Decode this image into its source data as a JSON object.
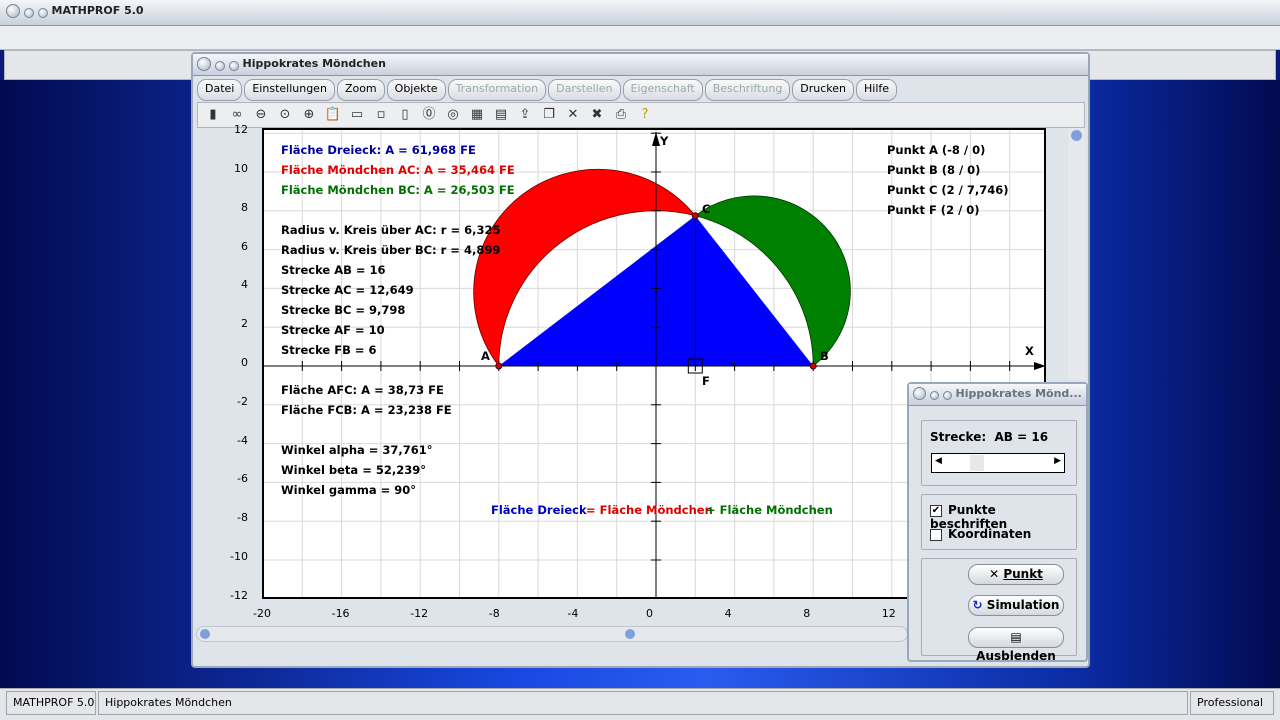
{
  "app": {
    "title": "MATHPROF 5.0"
  },
  "window": {
    "title": "Hippokrates Möndchen",
    "menu": [
      {
        "label": "Datei",
        "enabled": true
      },
      {
        "label": "Einstellungen",
        "enabled": true
      },
      {
        "label": "Zoom",
        "enabled": true
      },
      {
        "label": "Objekte",
        "enabled": true
      },
      {
        "label": "Transformation",
        "enabled": false
      },
      {
        "label": "Darstellen",
        "enabled": false
      },
      {
        "label": "Eigenschaft",
        "enabled": false
      },
      {
        "label": "Beschriftung",
        "enabled": false
      },
      {
        "label": "Drucken",
        "enabled": true
      },
      {
        "label": "Hilfe",
        "enabled": true
      }
    ],
    "toolbar": [
      "window-icon",
      "glasses-icon",
      "zoom-out-icon",
      "zoom-reset-icon",
      "zoom-in-icon",
      "clipboard-icon",
      "layout-icon",
      "frame-icon",
      "frame-double-icon",
      "circle-icon",
      "circle-at-icon",
      "table-icon",
      "document-icon",
      "export-icon",
      "copy-icon",
      "cross-icon",
      "cross-double-icon",
      "printer-icon",
      "help-icon"
    ]
  },
  "plot": {
    "info_colored": [
      {
        "text": "Fläche Dreieck: A = 61,968 FE",
        "color": "#0000a0"
      },
      {
        "text": "Fläche Möndchen AC: A = 35,464 FE",
        "color": "#e00000"
      },
      {
        "text": "Fläche Möndchen BC: A = 26,503 FE",
        "color": "#007000"
      }
    ],
    "info": [
      "Radius v. Kreis über AC: r = 6,325",
      "Radius v. Kreis über BC: r = 4,899",
      "Strecke AB = 16",
      "Strecke AC = 12,649",
      "Strecke BC = 9,798",
      "Strecke AF = 10",
      "Strecke FB = 6"
    ],
    "info2": [
      "Fläche AFC: A = 38,73 FE",
      "Fläche FCB: A = 23,238 FE"
    ],
    "angles": [
      "Winkel alpha = 37,761°",
      "Winkel beta = 52,239°",
      "Winkel gamma = 90°"
    ],
    "points": [
      "Punkt A (-8 / 0)",
      "Punkt B (8 / 0)",
      "Punkt C (2 / 7,746)",
      "Punkt F (2 / 0)"
    ],
    "equation": [
      {
        "text": "Fläche Dreieck",
        "color": "#0000c0"
      },
      {
        "text": "= Fläche Möndchen",
        "color": "#e00000"
      },
      {
        "text": "+ Fläche Möndchen",
        "color": "#007000"
      }
    ],
    "labels": {
      "A": "A",
      "B": "B",
      "C": "C",
      "F": "F",
      "x": "X",
      "y": "Y"
    },
    "x_ticks": [
      -20,
      -16,
      -12,
      -8,
      -4,
      0,
      4,
      8,
      12
    ],
    "y_ticks": [
      12,
      10,
      8,
      6,
      4,
      2,
      0,
      -2,
      -4,
      -6,
      -8,
      -10,
      -12
    ],
    "geometry": {
      "A": [
        -8,
        0
      ],
      "B": [
        8,
        0
      ],
      "C": [
        2,
        7.746
      ],
      "F": [
        2,
        0
      ],
      "r_AC": 6.325,
      "r_BC": 4.899,
      "r_AB": 8
    },
    "colors": {
      "triangle": "#0000ff",
      "lune_ac": "#ff0000",
      "lune_bc": "#008000"
    }
  },
  "dialog": {
    "title": "Hippokrates Mönd...",
    "slider_label": "Strecke:  AB = 16",
    "slider_value": 16,
    "checkboxes": [
      {
        "label": "Punkte beschriften",
        "checked": true
      },
      {
        "label": "Koordinaten",
        "checked": false
      }
    ],
    "buttons": [
      "Punkt",
      "Simulation",
      "Ausblenden"
    ]
  },
  "status": {
    "app": "MATHPROF 5.0",
    "doc": "Hippokrates Möndchen",
    "edition": "Professional"
  }
}
